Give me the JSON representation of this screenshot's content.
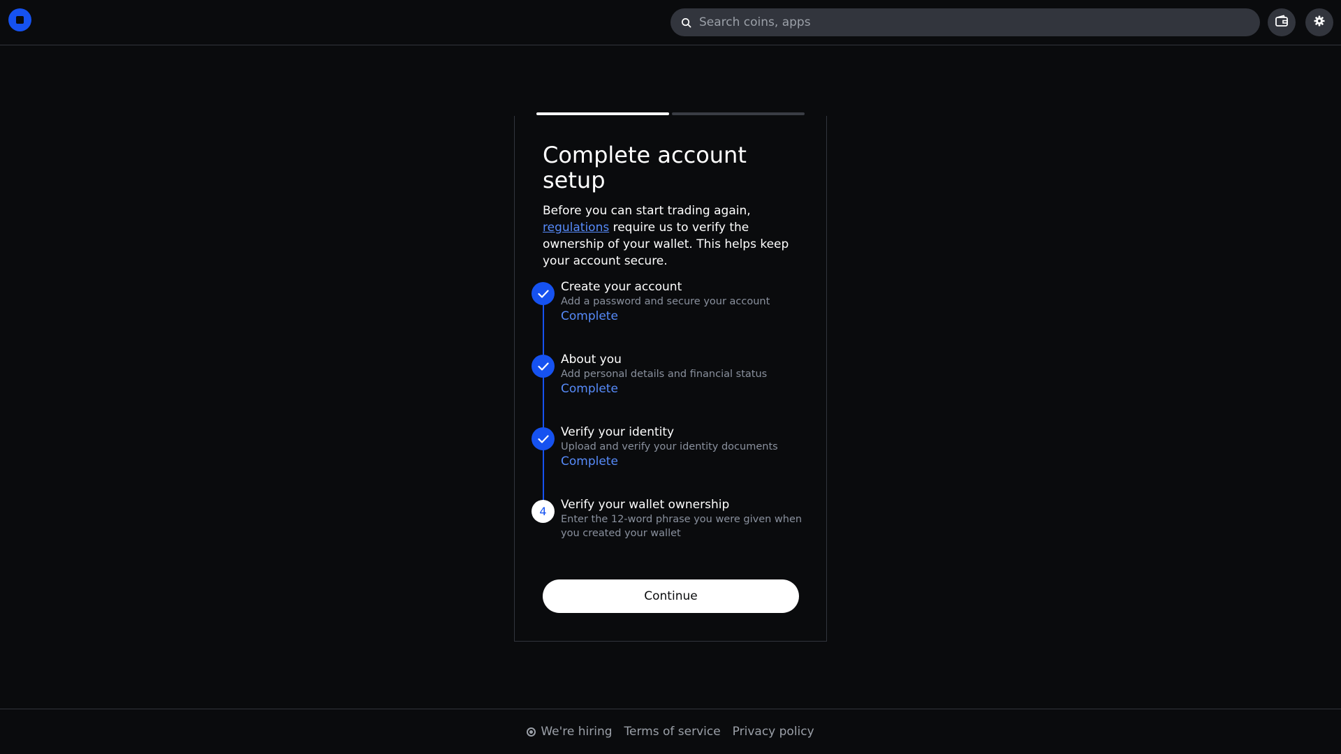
{
  "header": {
    "logo_icon": "coinbase-logo-icon",
    "search": {
      "placeholder": "Search coins, apps",
      "value": "",
      "icon": "search-icon"
    },
    "wallet_icon": "wallet-icon",
    "settings_icon": "gear-icon"
  },
  "progress": {
    "steps_total": 2,
    "current_step": 1
  },
  "card": {
    "title": "Complete account setup",
    "intro_before_link": "Before you can start trading again, ",
    "intro_link": "regulations",
    "intro_after_link": " require us to verify the ownership of your wallet. This helps keep your account secure.",
    "steps": [
      {
        "title": "Create your account",
        "description": "Add a password and secure your account",
        "status": "Complete",
        "done": true
      },
      {
        "title": "About you",
        "description": "Add personal details and financial status",
        "status": "Complete",
        "done": true
      },
      {
        "title": "Verify your identity",
        "description": "Upload and verify your identity documents",
        "status": "Complete",
        "done": true
      },
      {
        "number": "4",
        "title": "Verify your wallet ownership",
        "description": "Enter the 12-word phrase you were given when you created your wallet",
        "done": false
      }
    ],
    "continue_label": "Continue"
  },
  "footer": {
    "hiring": "We're hiring",
    "terms": "Terms of service",
    "privacy": "Privacy policy"
  },
  "colors": {
    "background": "#0a0b0d",
    "accent": "#1652f0",
    "link": "#578bfa",
    "border": "#32353d"
  }
}
